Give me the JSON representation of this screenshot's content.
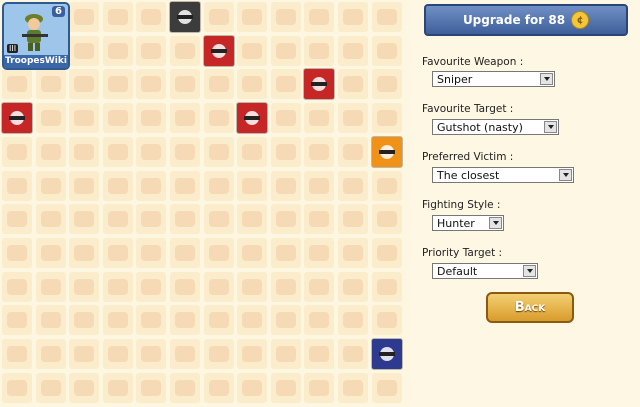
{
  "profile": {
    "name": "TroopesWiki",
    "level": "6",
    "ammo": "III"
  },
  "upgrade": {
    "label": "Upgrade for 88",
    "coin_icon": "coin-icon"
  },
  "fields": [
    {
      "label": "Favourite Weapon :",
      "value": "Sniper"
    },
    {
      "label": "Favourite Target :",
      "value": "Gutshot (nasty)"
    },
    {
      "label": "Preferred Victim :",
      "value": "The closest"
    },
    {
      "label": "Fighting Style :",
      "value": "Hunter"
    },
    {
      "label": "Priority Target :",
      "value": "Default"
    }
  ],
  "back_label": "Back",
  "grid": {
    "columns": 12,
    "rows": 12,
    "highlighted": [
      {
        "name": "helmet-skill-icon",
        "col": 5,
        "row": 0,
        "color": "#3c3c3c"
      },
      {
        "name": "rifle-star-skill-icon",
        "col": 6,
        "row": 1,
        "color": "#c62626"
      },
      {
        "name": "rocket-skill-icon",
        "col": 9,
        "row": 2,
        "color": "#c62626"
      },
      {
        "name": "gun-skill-icon",
        "col": 0,
        "row": 3,
        "color": "#c62626"
      },
      {
        "name": "missile-skill-icon",
        "col": 7,
        "row": 3,
        "color": "#c62626"
      },
      {
        "name": "explosion-skill-icon",
        "col": 11,
        "row": 4,
        "color": "#f09218"
      },
      {
        "name": "shield-skill-icon",
        "col": 11,
        "row": 10,
        "color": "#2d3a8f"
      }
    ]
  }
}
